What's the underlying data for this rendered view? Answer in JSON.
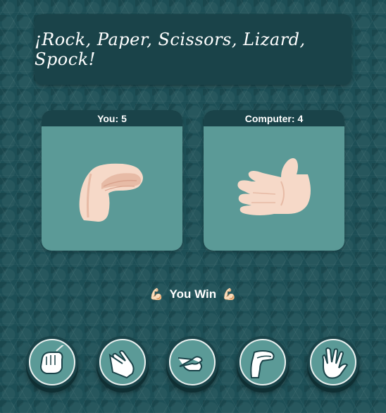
{
  "title": "¡Rock, Paper, Scissors, Lizard, Spock!",
  "score": {
    "you_label": "You:",
    "you_value": "5",
    "computer_label": "Computer:",
    "computer_value": "4"
  },
  "you_choice_icon": "lizard-hand-icon",
  "computer_choice_icon": "paper-hand-icon",
  "result": {
    "text": "You Win",
    "emoji_left": "💪🏻",
    "emoji_right": "💪🏻"
  },
  "choices": [
    {
      "name": "rock",
      "icon": "rock-hand-icon"
    },
    {
      "name": "paper",
      "icon": "paper-hand-icon"
    },
    {
      "name": "scissors",
      "icon": "scissors-hand-icon"
    },
    {
      "name": "lizard",
      "icon": "lizard-hand-icon"
    },
    {
      "name": "spock",
      "icon": "spock-hand-icon"
    }
  ],
  "colors": {
    "background": "#1d4f56",
    "panel_dark": "#1a4349",
    "panel_light": "#5b9a97",
    "skin": "#f6d9c8",
    "skin_shadow": "#e7bba6"
  }
}
